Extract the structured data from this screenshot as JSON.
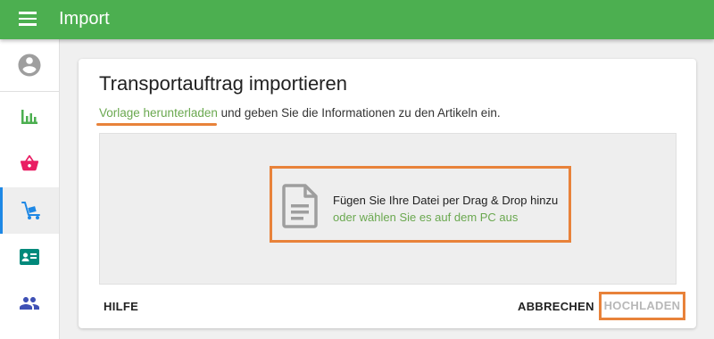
{
  "topbar": {
    "title": "Import",
    "menu_icon": "menu-icon"
  },
  "sidebar": {
    "items": [
      {
        "name": "account",
        "icon": "account-circle-icon",
        "color": "#9e9e9e"
      },
      {
        "name": "statistics",
        "icon": "bar-chart-icon",
        "color": "#4caf50"
      },
      {
        "name": "shop",
        "icon": "basket-icon",
        "color": "#e91e63"
      },
      {
        "name": "transport",
        "icon": "hand-truck-icon",
        "color": "#1e88e5",
        "active": true
      },
      {
        "name": "contacts",
        "icon": "contact-card-icon",
        "color": "#00897b"
      },
      {
        "name": "users",
        "icon": "people-icon",
        "color": "#3f51b5"
      }
    ]
  },
  "card": {
    "title": "Transportauftrag importieren",
    "template_link": "Vorlage herunterladen",
    "subtitle_rest": " und geben Sie die Informationen zu den Artikeln ein.",
    "dropzone": {
      "text": "Fügen Sie Ihre Datei per Drag & Drop hinzu",
      "link": "oder wählen Sie es auf dem PC aus",
      "icon": "file-document-icon"
    },
    "buttons": {
      "help": "HILFE",
      "cancel": "ABBRECHEN",
      "upload": "HOCHLADEN"
    }
  },
  "colors": {
    "primary": "#4caf50",
    "link": "#6aa84f",
    "highlight": "#e8823a",
    "disabled": "#b8b8b8"
  }
}
